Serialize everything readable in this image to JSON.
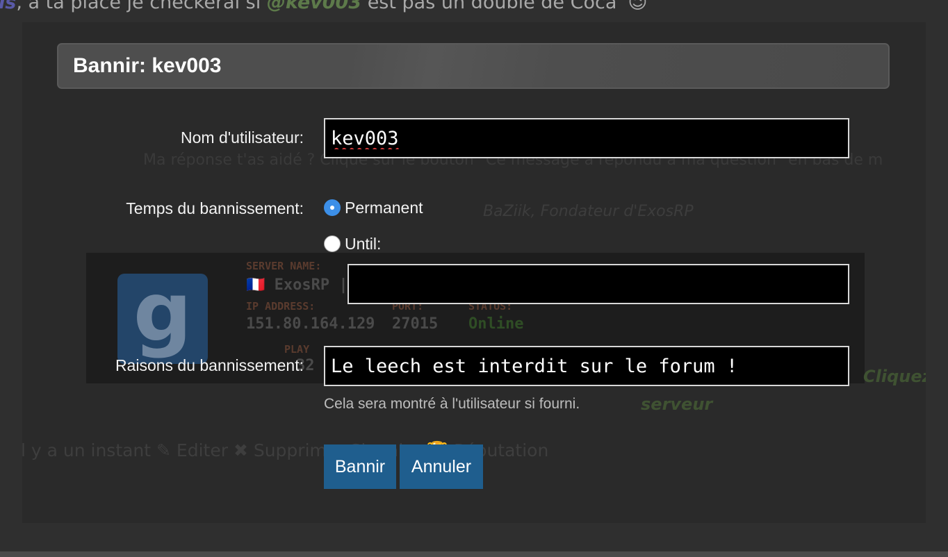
{
  "background": {
    "quote_name_tail": "is",
    "quote_text_1": ", à ta place je checkerai si ",
    "quote_mention": "@kev003",
    "quote_text_2": " est pas un double de Coca' ",
    "quote_emoji": "😉"
  },
  "ghost": {
    "help_line": "Ma réponse t'as aidé ? Clique sur le bouton \"Ce message a répondu à ma question\" en bas de m",
    "signature": "BaZiik, Fondateur d'ExosRP",
    "server": {
      "logo_letter": "g",
      "name_label": "SERVER NAME:",
      "name": "🇫🇷 ExosRP | Recrutement Off | M9K CW | FR |...",
      "ip_label": "IP ADDRESS:",
      "ip": "151.80.164.129",
      "port_label": "PORT:",
      "port": "27015",
      "status_label": "STATUS:",
      "status": "Online",
      "players_label": "PLAY",
      "players_partial": "32"
    },
    "click_text": "Cliquez i",
    "serveur_text": "serveur",
    "author_tail": "k",
    "actions": ",Il y a un instant  ✎ Editer  ✖ Supprimer      Signaler  🏆 Réputation"
  },
  "modal": {
    "title": "Bannir: kev003",
    "username_label": "Nom d'utilisateur:",
    "username_value": "kev003",
    "ban_time_label": "Temps du bannissement:",
    "options": {
      "permanent": "Permanent",
      "until": "Until:"
    },
    "selected_option": "permanent",
    "until_value": "",
    "reason_label": "Raisons du bannissement:",
    "reason_value": "Le leech est interdit sur le forum !",
    "reason_hint": "Cela sera montré à l'utilisateur si fourni.",
    "ban_button": "Bannir",
    "cancel_button": "Annuler"
  }
}
